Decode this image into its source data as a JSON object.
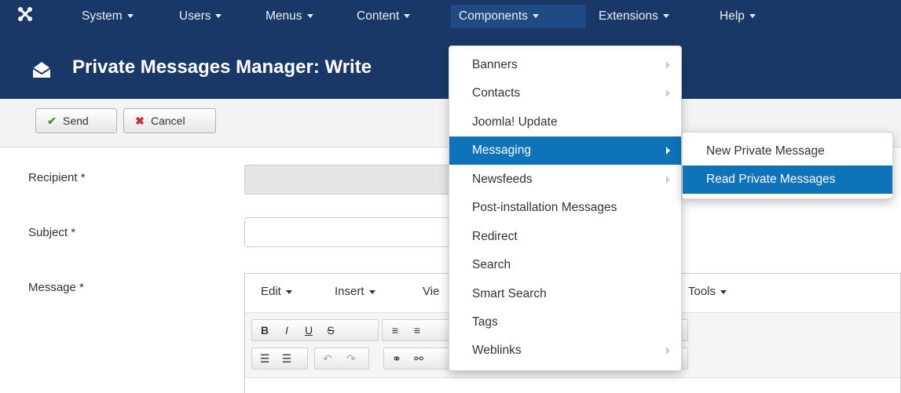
{
  "navbar": {
    "logo_icon": "joomla-logo-icon",
    "items": [
      {
        "label": "System"
      },
      {
        "label": "Users"
      },
      {
        "label": "Menus"
      },
      {
        "label": "Content"
      },
      {
        "label": "Components"
      },
      {
        "label": "Extensions"
      },
      {
        "label": "Help"
      }
    ]
  },
  "header": {
    "icon": "envelope-icon",
    "title": "Private Messages Manager: Write"
  },
  "toolbar": {
    "send_label": "Send",
    "send_icon": "checkmark-icon",
    "cancel_label": "Cancel",
    "cancel_icon": "cancel-icon"
  },
  "form": {
    "recipient_label": "Recipient *",
    "recipient_value": "",
    "subject_label": "Subject *",
    "subject_value": "",
    "message_label": "Message *"
  },
  "editor": {
    "menus": [
      {
        "label": "Edit"
      },
      {
        "label": "Insert"
      },
      {
        "label": "Vie"
      },
      {
        "label": "Tools"
      }
    ],
    "row1_buttons": [
      "B",
      "I",
      "U",
      "S",
      "≡",
      "≡"
    ],
    "row2_buttons": [
      "☰",
      "☰",
      "↶",
      "↷",
      "⚭",
      "⚯"
    ]
  },
  "components_menu": {
    "items": [
      {
        "label": "Banners"
      },
      {
        "label": "Contacts"
      },
      {
        "label": "Joomla! Update"
      },
      {
        "label": "Messaging"
      },
      {
        "label": "Newsfeeds"
      },
      {
        "label": "Post-installation Messages"
      },
      {
        "label": "Redirect"
      },
      {
        "label": "Search"
      },
      {
        "label": "Smart Search"
      },
      {
        "label": "Tags"
      },
      {
        "label": "Weblinks"
      }
    ]
  },
  "messaging_submenu": {
    "items": [
      {
        "label": "New Private Message"
      },
      {
        "label": "Read Private Messages"
      }
    ]
  },
  "colors": {
    "navbar_bg": "#1a3867",
    "highlight": "#0e73b8",
    "send_check": "#3a9a2a",
    "cancel_red": "#c9302c"
  }
}
